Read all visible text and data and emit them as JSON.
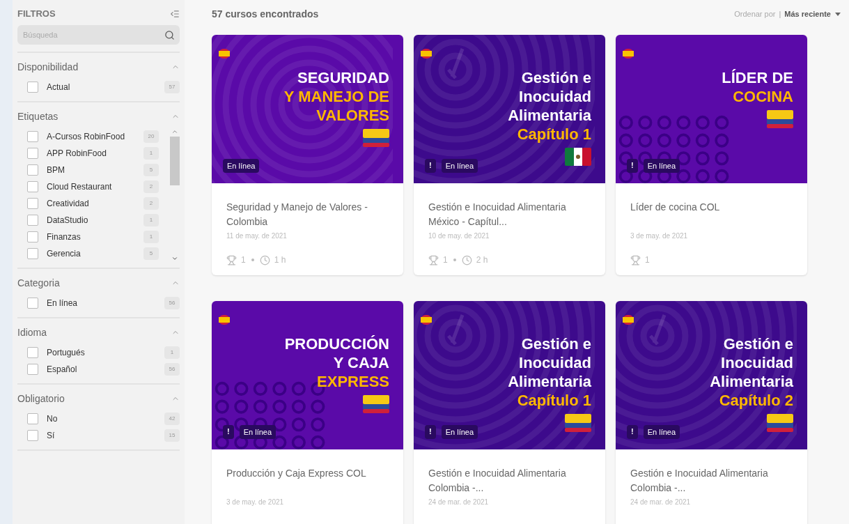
{
  "sidebar": {
    "title": "FILTROS",
    "search": {
      "placeholder": "Búsqueda"
    },
    "sections": [
      {
        "title": "Disponibilidad",
        "expanded": true,
        "scroll": false,
        "options": [
          {
            "label": "Actual",
            "count": "57",
            "checked": false
          }
        ]
      },
      {
        "title": "Etiquetas",
        "expanded": true,
        "scroll": true,
        "options": [
          {
            "label": "A-Cursos RobinFood",
            "count": "20",
            "checked": false
          },
          {
            "label": "APP RobinFood",
            "count": "1",
            "checked": false
          },
          {
            "label": "BPM",
            "count": "5",
            "checked": false
          },
          {
            "label": "Cloud Restaurant",
            "count": "2",
            "checked": false
          },
          {
            "label": "Creatividad",
            "count": "2",
            "checked": false
          },
          {
            "label": "DataStudio",
            "count": "1",
            "checked": false
          },
          {
            "label": "Finanzas",
            "count": "1",
            "checked": false
          },
          {
            "label": "Gerencia",
            "count": "5",
            "checked": false
          }
        ]
      },
      {
        "title": "Categoria",
        "expanded": true,
        "scroll": false,
        "options": [
          {
            "label": "En línea",
            "count": "56",
            "checked": false
          }
        ]
      },
      {
        "title": "Idioma",
        "expanded": true,
        "scroll": false,
        "options": [
          {
            "label": "Portugués",
            "count": "1",
            "checked": false
          },
          {
            "label": "Español",
            "count": "56",
            "checked": false
          }
        ]
      },
      {
        "title": "Obligatorio",
        "expanded": true,
        "scroll": false,
        "options": [
          {
            "label": "No",
            "count": "42",
            "checked": false
          },
          {
            "label": "Sí",
            "count": "15",
            "checked": false
          }
        ]
      }
    ]
  },
  "results": {
    "count_label": "57 cursos encontrados",
    "sort_label": "Ordenar por",
    "sort_separator": "|",
    "sort_value": "Más reciente"
  },
  "courses": [
    {
      "kind": "rings",
      "flag": {
        "kind": "colombia"
      },
      "badge": "En línea",
      "lines": [
        {
          "text": "SEGURIDAD",
          "accent": false
        },
        {
          "text": "Y MANEJO DE",
          "accent": true
        },
        {
          "text": "VALORES",
          "accent": true
        }
      ],
      "title": "Seguridad y Manejo de Valores - Colombia",
      "date": "11 de may. de 2021",
      "trophies": "1",
      "duration": "1 h"
    },
    {
      "kind": "target",
      "flag": {
        "kind": "mexico"
      },
      "alert": "!",
      "badge": "En línea",
      "lines": [
        {
          "text": "Gestión e",
          "accent": false
        },
        {
          "text": "Inocuidad",
          "accent": false
        },
        {
          "text": "Alimentaria",
          "accent": false
        },
        {
          "text": "Capítulo 1",
          "accent": true
        }
      ],
      "title": "Gestión e Inocuidad Alimentaria México - Capítul...",
      "date": "10 de may. de 2021",
      "trophies": "1",
      "duration": "2 h"
    },
    {
      "kind": "dots",
      "flag": {
        "kind": "colombia"
      },
      "alert": "!",
      "badge": "En línea",
      "lines": [
        {
          "text": "LÍDER DE",
          "accent": false
        },
        {
          "text": "COCINA",
          "accent": true
        }
      ],
      "title": "Líder de cocina COL",
      "date": "3 de may. de 2021",
      "trophies": "1"
    },
    {
      "kind": "dots",
      "flag": {
        "kind": "colombia"
      },
      "alert": "!",
      "badge": "En línea",
      "lines": [
        {
          "text": "PRODUCCIÓN",
          "accent": false
        },
        {
          "text": "Y CAJA",
          "accent": false
        },
        {
          "text": "EXPRESS",
          "accent": true
        }
      ],
      "title": "Producción y Caja Express COL",
      "date": "3 de may. de 2021"
    },
    {
      "kind": "target",
      "flag": {
        "kind": "colombia"
      },
      "alert": "!",
      "badge": "En línea",
      "lines": [
        {
          "text": "Gestión e",
          "accent": false
        },
        {
          "text": "Inocuidad",
          "accent": false
        },
        {
          "text": "Alimentaria",
          "accent": false
        },
        {
          "text": "Capítulo 1",
          "accent": true
        }
      ],
      "title": "Gestión e Inocuidad Alimentaria Colombia -...",
      "date": "24 de mar. de 2021"
    },
    {
      "kind": "target",
      "flag": {
        "kind": "colombia"
      },
      "alert": "!",
      "badge": "En línea",
      "lines": [
        {
          "text": "Gestión e",
          "accent": false
        },
        {
          "text": "Inocuidad",
          "accent": false
        },
        {
          "text": "Alimentaria",
          "accent": false
        },
        {
          "text": "Capítulo 2",
          "accent": true
        }
      ],
      "title": "Gestión e Inocuidad Alimentaria Colombia -...",
      "date": "24 de mar. de 2021"
    }
  ]
}
